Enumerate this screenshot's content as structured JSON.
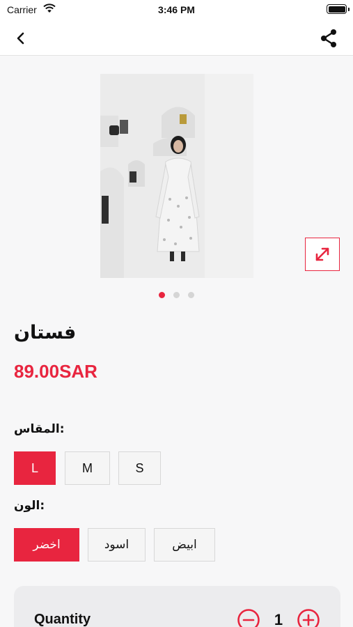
{
  "status_bar": {
    "carrier": "Carrier",
    "time": "3:46 PM",
    "battery_level": 1.0
  },
  "nav": {
    "back_icon": "chevron-left-icon",
    "share_icon": "share-icon"
  },
  "gallery": {
    "image_description_icon": "product-photo",
    "expand_icon": "expand-arrows-icon",
    "page_count": 3,
    "active_index": 0
  },
  "product": {
    "title": "فستان",
    "price": "89.00SAR"
  },
  "size": {
    "label": "المقاس:",
    "options": [
      "L",
      "M",
      "S"
    ],
    "selected": "L"
  },
  "color": {
    "label": "الون:",
    "options": [
      "اخضر",
      "اسود",
      "ابيض"
    ],
    "selected": "اخضر"
  },
  "quantity": {
    "label": "Quantity",
    "value": "1"
  },
  "theme": {
    "accent": "#e8253f",
    "background": "#f7f7f8"
  }
}
